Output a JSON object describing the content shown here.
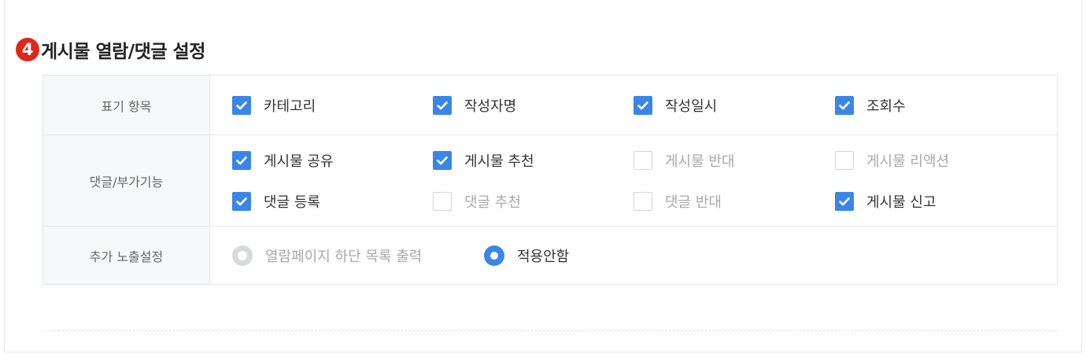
{
  "section": {
    "number": "4",
    "title": "게시물 열람/댓글 설정"
  },
  "rows": {
    "display_items": {
      "label": "표기 항목",
      "options": [
        {
          "label": "카테고리",
          "checked": true
        },
        {
          "label": "작성자명",
          "checked": true
        },
        {
          "label": "작성일시",
          "checked": true
        },
        {
          "label": "조회수",
          "checked": true
        }
      ]
    },
    "comment_features": {
      "label": "댓글/부가기능",
      "options": [
        {
          "label": "게시물 공유",
          "checked": true
        },
        {
          "label": "게시물 추천",
          "checked": true
        },
        {
          "label": "게시물 반대",
          "checked": false
        },
        {
          "label": "게시물 리액션",
          "checked": false
        },
        {
          "label": "댓글 등록",
          "checked": true
        },
        {
          "label": "댓글 추천",
          "checked": false
        },
        {
          "label": "댓글 반대",
          "checked": false
        },
        {
          "label": "게시물 신고",
          "checked": true
        }
      ]
    },
    "extra_exposure": {
      "label": "추가 노출설정",
      "options": [
        {
          "label": "열람페이지 하단 목록 출력",
          "selected": false
        },
        {
          "label": "적용안함",
          "selected": true
        }
      ]
    }
  },
  "colors": {
    "accent": "#3a86e8",
    "badge": "#e1251b",
    "label_bg": "#f6f8fa",
    "border": "#e3e6ea"
  }
}
